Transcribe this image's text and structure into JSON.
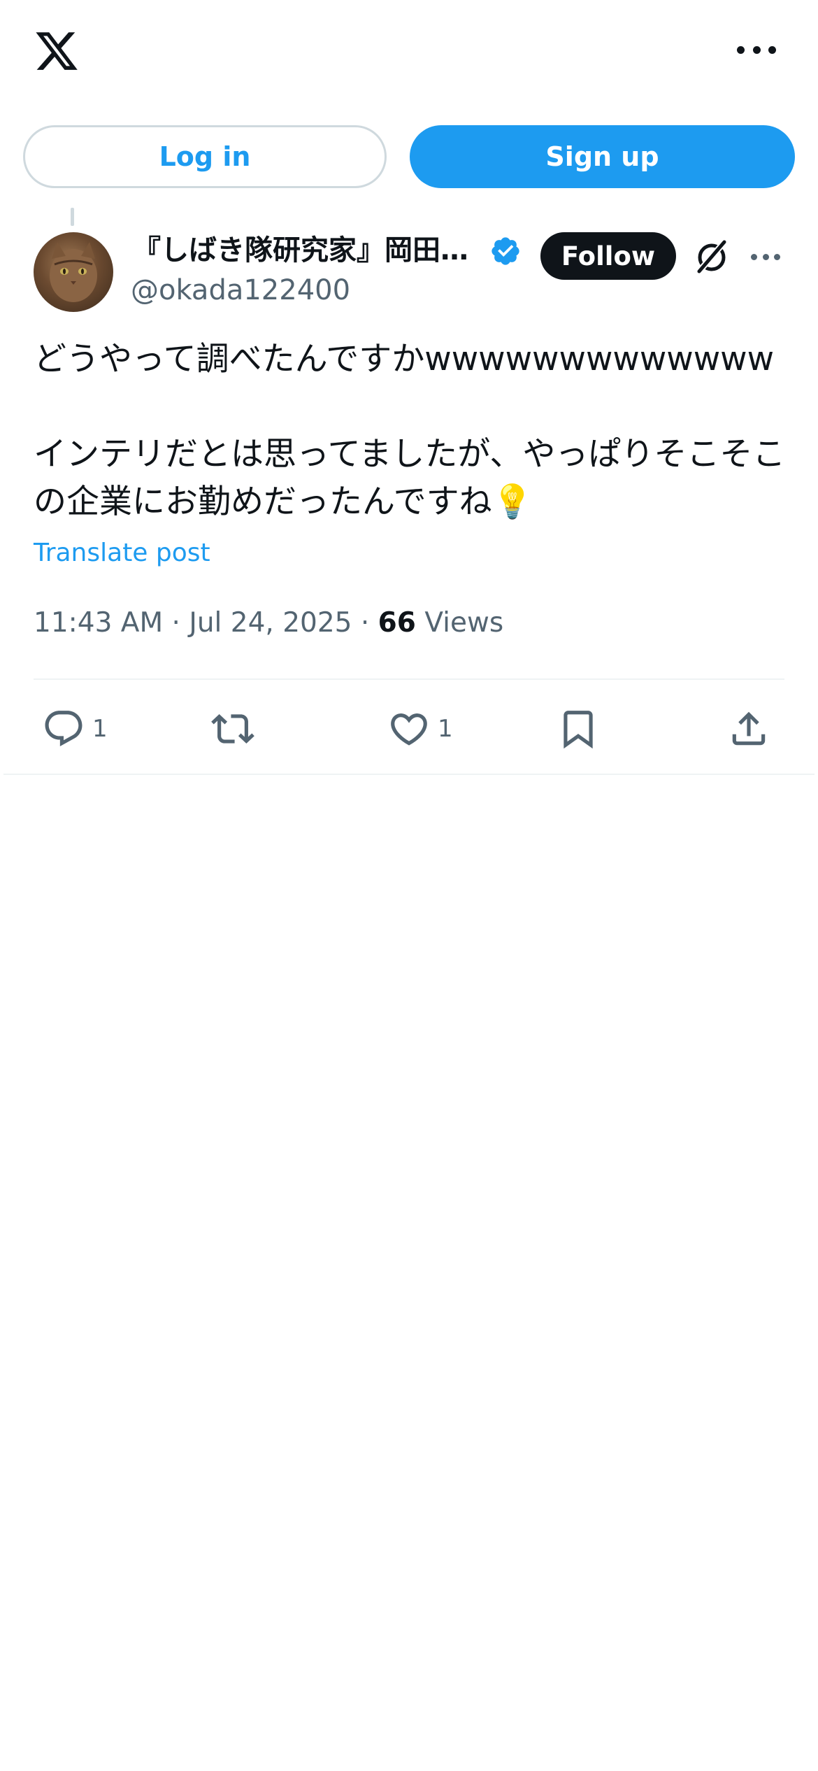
{
  "colors": {
    "accent": "#1d9bf0",
    "text": "#0f1419",
    "secondary_text": "#536471",
    "border": "#cfd9de",
    "divider": "#eff3f4"
  },
  "header": {
    "logo_icon": "x-logo-icon",
    "more_icon": "more-horizontal-icon"
  },
  "auth": {
    "login_label": "Log in",
    "signup_label": "Sign up"
  },
  "post": {
    "author_name": "『しばき隊研究家』岡田…",
    "handle": "@okada122400",
    "verified_icon": "verified-badge-icon",
    "follow_label": "Follow",
    "grok_icon": "grok-icon",
    "more_icon": "more-horizontal-icon",
    "text": "どうやって調べたんですかwwwwwwwwwwwww\n\nインテリだとは思ってましたが、やっぱりそこそこの企業にお勤めだったんですね💡",
    "translate_label": "Translate post",
    "time": "11:43 AM",
    "date": "Jul 24, 2025",
    "views_count": "66",
    "views_label": "Views"
  },
  "actions": {
    "reply_icon": "reply-icon",
    "reply_count": "1",
    "repost_icon": "repost-icon",
    "like_icon": "heart-icon",
    "like_count": "1",
    "bookmark_icon": "bookmark-icon",
    "share_icon": "share-icon"
  }
}
